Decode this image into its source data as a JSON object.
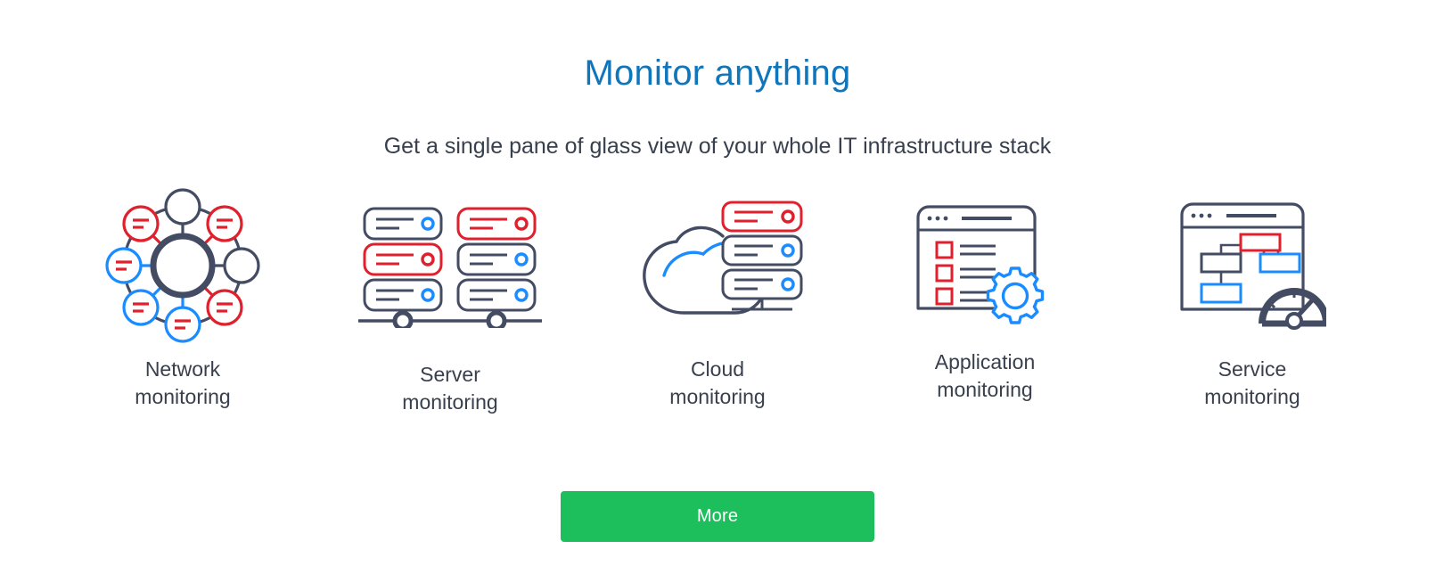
{
  "section": {
    "title": "Monitor anything",
    "subtitle": "Get a single pane of glass view of your whole IT infrastructure stack"
  },
  "cards": [
    {
      "id": "network",
      "label": "Network\nmonitoring",
      "icon": "network-monitoring-icon"
    },
    {
      "id": "server",
      "label": "Server\nmonitoring",
      "icon": "server-monitoring-icon"
    },
    {
      "id": "cloud",
      "label": "Cloud\nmonitoring",
      "icon": "cloud-monitoring-icon"
    },
    {
      "id": "application",
      "label": "Application\nmonitoring",
      "icon": "application-monitoring-icon"
    },
    {
      "id": "service",
      "label": "Service\nmonitoring",
      "icon": "service-monitoring-icon"
    }
  ],
  "cta": {
    "label": "More"
  },
  "colors": {
    "heading_blue": "#1076bc",
    "text_dark": "#38404e",
    "icon_navy": "#434c63",
    "icon_red": "#e0202c",
    "icon_blue": "#1a8cff",
    "cta_green": "#1dbf5c",
    "background": "#ffffff"
  }
}
